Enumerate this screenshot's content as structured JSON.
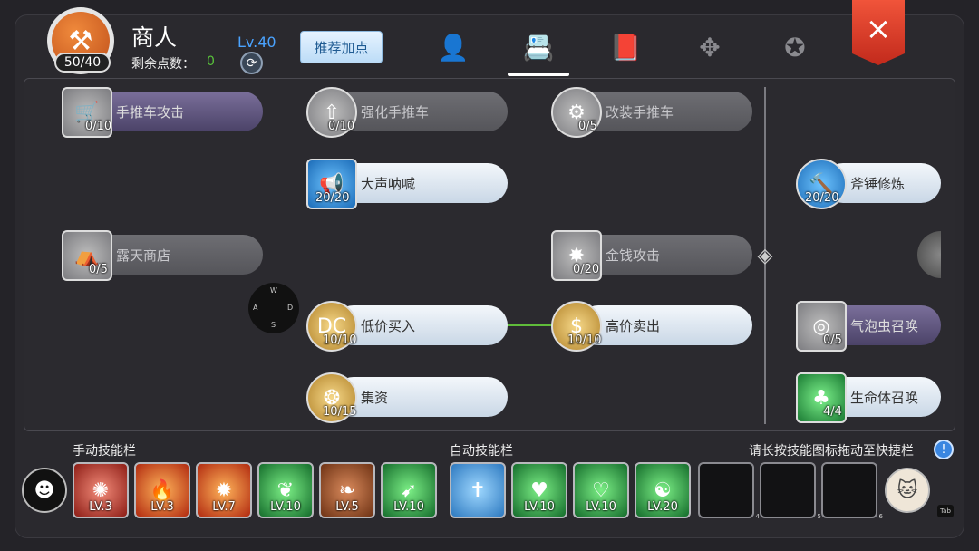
{
  "header": {
    "job_title": "商人",
    "xp": "50/40",
    "remaining_label": "剩余点数：",
    "remaining_points": "0",
    "level": "Lv.40",
    "recommend_button": "推荐加点",
    "close_icon": "×"
  },
  "tree": {
    "skills": [
      {
        "name": "手推车攻击",
        "level": "0/10",
        "icon": "cart-icon",
        "state": "purple"
      },
      {
        "name": "强化手推车",
        "level": "0/10",
        "icon": "cart-upgrade-icon",
        "state": "dim"
      },
      {
        "name": "改装手推车",
        "level": "0/5",
        "icon": "cart-remodel-icon",
        "state": "dim"
      },
      {
        "name": "大声呐喊",
        "level": "20/20",
        "icon": "shout-icon",
        "state": "lit"
      },
      {
        "name": "斧锤修炼",
        "level": "20/20",
        "icon": "axe-icon",
        "state": "lit"
      },
      {
        "name": "露天商店",
        "level": "0/5",
        "icon": "tent-icon",
        "state": "dim"
      },
      {
        "name": "金钱攻击",
        "level": "0/20",
        "icon": "money-attack-icon",
        "state": "dim"
      },
      {
        "name": "低价买入",
        "level": "10/10",
        "icon": "discount-icon",
        "state": "lit"
      },
      {
        "name": "高价卖出",
        "level": "10/10",
        "icon": "dollar-icon",
        "state": "lit"
      },
      {
        "name": "气泡虫召唤",
        "level": "0/5",
        "icon": "bubble-icon",
        "state": "purple"
      },
      {
        "name": "集资",
        "level": "10/15",
        "icon": "coins-icon",
        "state": "lit"
      },
      {
        "name": "生命体召唤",
        "level": "4/4",
        "icon": "summon-icon",
        "state": "lit"
      }
    ],
    "wasd": {
      "w": "W",
      "a": "A",
      "s": "S",
      "d": "D"
    }
  },
  "hotbar": {
    "manual_label": "手动技能栏",
    "auto_label": "自动技能栏",
    "hint": "请长按技能图标拖动至快捷栏",
    "info_icon": "!",
    "manual_slots": [
      "LV.3",
      "LV.3",
      "LV.7",
      "LV.10",
      "LV.5",
      "LV.10"
    ],
    "auto_slots": [
      "",
      "LV.10",
      "LV.10",
      "LV.20"
    ],
    "empty_slot_numbers": [
      "4",
      "5",
      "6"
    ],
    "tab_key": "Tab"
  }
}
